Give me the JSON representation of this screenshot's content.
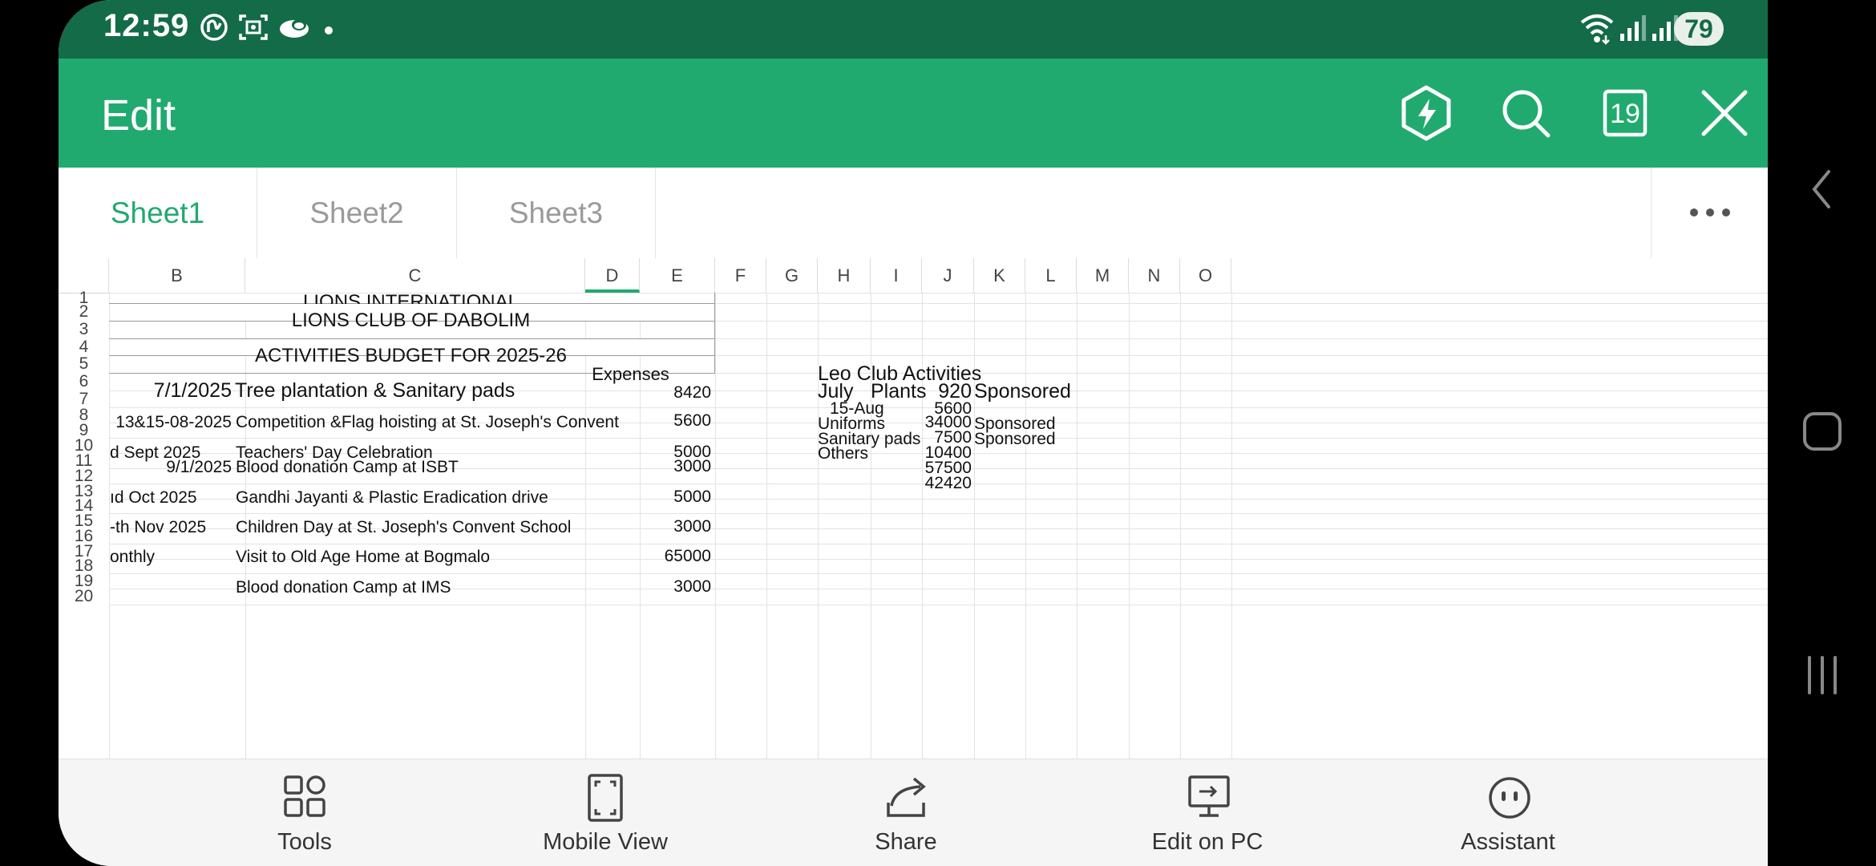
{
  "status_bar": {
    "time": "12:59",
    "battery": "79"
  },
  "toolbar": {
    "title": "Edit",
    "calendar_day": "19"
  },
  "tabs": [
    {
      "label": "Sheet1",
      "active": true
    },
    {
      "label": "Sheet2",
      "active": false
    },
    {
      "label": "Sheet3",
      "active": false
    }
  ],
  "columns": [
    "B",
    "C",
    "D",
    "E",
    "F",
    "G",
    "H",
    "I",
    "J",
    "K",
    "L",
    "M",
    "N",
    "O"
  ],
  "rows": [
    "1",
    "2",
    "3",
    "4",
    "5",
    "6",
    "7",
    "8",
    "9",
    "10",
    "11",
    "12",
    "13",
    "14",
    "15",
    "16",
    "17",
    "18",
    "19",
    "20"
  ],
  "cells": {
    "r1": "LIONS  INTERNATIONAL",
    "r2": "LIONS CLUB OF DABOLIM",
    "r4": "ACTIVITIES BUDGET FOR 2025-26",
    "e5": "Expenses",
    "b6": "7/1/2025",
    "c6": "Tree plantation & Sanitary pads",
    "e6": "8420",
    "b8": "13&15-08-2025",
    "c8": "Competition &Flag hoisting  at St. Joseph's Convent",
    "e8": "5600",
    "b10": "d Sept 2025",
    "c10": "Teachers' Day Celebration",
    "e10": "5000",
    "b11": "9/1/2025",
    "c11": "Blood donation Camp at ISBT",
    "e11": "3000",
    "b13": "ıd Oct 2025",
    "c13": "Gandhi Jayanti & Plastic Eradication drive",
    "e13": "5000",
    "b15": "-th Nov 2025",
    "c15": "Children Day at  St. Joseph's Convent School",
    "e15": "3000",
    "b17": "onthly",
    "c17": "Visit to Old Age Home at Bogmalo",
    "e17": "65000",
    "c19": "Blood donation Camp at IMS",
    "e19": "3000",
    "h5": "Leo Club Activities",
    "h6": "July",
    "i6": "Plants",
    "j6": "920",
    "k6": "Sponsored",
    "h7": "15-Aug",
    "j7": "5600",
    "h8": "Uniforms",
    "j8": "34000",
    "k8": "Sponsored",
    "h9": "Sanitary pads",
    "j9": "7500",
    "k9": "Sponsored",
    "h10": "Others",
    "j10": "10400",
    "j11": "57500",
    "j12": "42420"
  },
  "bottom_bar": [
    {
      "label": "Tools",
      "icon": "tools-icon"
    },
    {
      "label": "Mobile View",
      "icon": "mobile-view-icon"
    },
    {
      "label": "Share",
      "icon": "share-icon"
    },
    {
      "label": "Edit on PC",
      "icon": "edit-on-pc-icon"
    },
    {
      "label": "Assistant",
      "icon": "assistant-icon"
    }
  ],
  "colors": {
    "status_bar": "#146b47",
    "toolbar": "#21aa6f",
    "accent": "#21aa6f"
  }
}
